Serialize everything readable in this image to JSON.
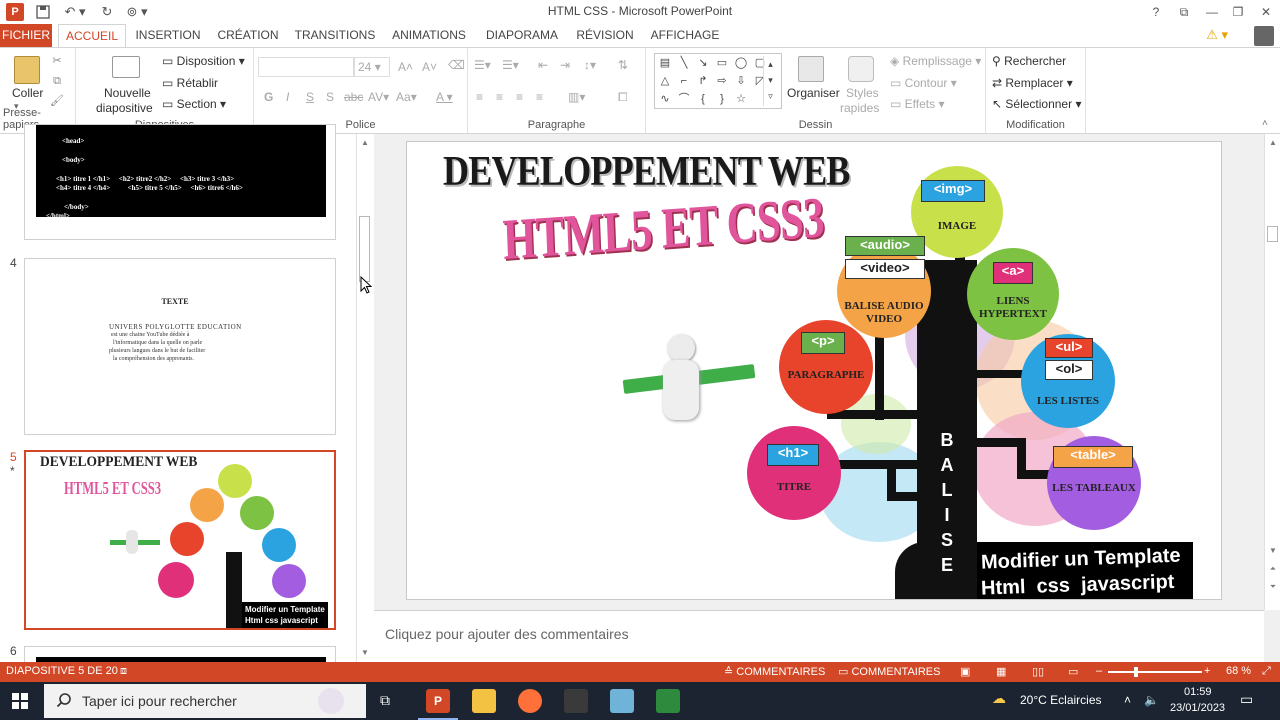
{
  "window": {
    "title": "HTML  CSS - Microsoft PowerPoint",
    "help": "?"
  },
  "tabs": [
    {
      "label": "FICHIER"
    },
    {
      "label": "ACCUEIL"
    },
    {
      "label": "INSERTION"
    },
    {
      "label": "CRÉATION"
    },
    {
      "label": "TRANSITIONS"
    },
    {
      "label": "ANIMATIONS"
    },
    {
      "label": "DIAPORAMA"
    },
    {
      "label": "RÉVISION"
    },
    {
      "label": "AFFICHAGE"
    }
  ],
  "ribbon": {
    "clipboard": {
      "paste": "Coller",
      "group": "Presse-papiers"
    },
    "slides": {
      "new_slide": "Nouvelle",
      "new_slide_2": "diapositive",
      "layout": "Disposition",
      "reset": "Rétablir",
      "section": "Section",
      "group": "Diapositives"
    },
    "font": {
      "size": "24",
      "bold": "G",
      "italic": "I",
      "underline": "S",
      "shadow": "S",
      "strike": "abc",
      "spacing": "AV",
      "case": "Aa",
      "group": "Police"
    },
    "paragraph": {
      "group": "Paragraphe"
    },
    "drawing": {
      "arrange": "Organiser",
      "styles": "Styles",
      "styles_2": "rapides",
      "fill": "Remplissage",
      "outline": "Contour",
      "effects": "Effets",
      "group": "Dessin"
    },
    "editing": {
      "find": "Rechercher",
      "replace": "Remplacer",
      "select": "Sélectionner",
      "group": "Modification"
    }
  },
  "thumbnails": {
    "slide3": {
      "lines": [
        "<head>",
        "<body>",
        "<h1> titre 1 </h1>     <h2> titre2 </h2>     <h3> titre 3 </h3>",
        "<h4> titre 4 </h4>          <h5> titre 5 </h5>     <h6> titre6 </h6>",
        "</body>",
        "</html>"
      ]
    },
    "slide4": {
      "num": "4",
      "title": "TEXTE",
      "lines": [
        "UNIVERS POLYGLOTTE EDUCATION",
        "est une chaine YouTube dédiée à",
        "l'informatique dans la quelle on parle",
        "plusieurs langues dans le but de faciliter",
        "la compréhension des apprenants."
      ]
    },
    "slide5": {
      "num": "5",
      "star": "*"
    },
    "slide6": {
      "num": "6"
    }
  },
  "slide": {
    "title1": "DEVELOPPEMENT WEB",
    "title2": "HTML5 ET CSS3",
    "trunk_letters": [
      "B",
      "A",
      "L",
      "I",
      "S",
      "E"
    ],
    "nodes": [
      {
        "tag": "<img>",
        "label": "IMAGE",
        "color": "#c8e04a"
      },
      {
        "tag": "<audio>",
        "tag2": "<video>",
        "label": "BALISE AUDIO VIDEO",
        "color": "#f5a347"
      },
      {
        "tag": "<a>",
        "label": "LIENS HYPERTEXT",
        "color": "#7dc242"
      },
      {
        "tag": "<p>",
        "label": "PARAGRAPHE",
        "color": "#e8432b"
      },
      {
        "tag": "<ul>",
        "tag2": "<ol>",
        "label": "LES LISTES",
        "color": "#2aa3e0"
      },
      {
        "tag": "<h1>",
        "label": "TITRE",
        "color": "#e0307a"
      },
      {
        "tag": "<table>",
        "label": "LES TABLEAUX",
        "color": "#a35de0"
      }
    ],
    "banner1": "Modifier un Template",
    "banner2": "Html  css  javascript"
  },
  "notes": {
    "placeholder": "Cliquez pour ajouter des commentaires"
  },
  "status": {
    "slide_info": "DIAPOSITIVE 5 DE 20",
    "notes_btn": "COMMENTAIRES",
    "comments_btn": "COMMENTAIRES",
    "zoom": "68 %"
  },
  "taskbar": {
    "search": "Taper ici pour rechercher",
    "weather": "20°C  Eclaircies",
    "time": "01:59",
    "date": "23/01/2023"
  }
}
